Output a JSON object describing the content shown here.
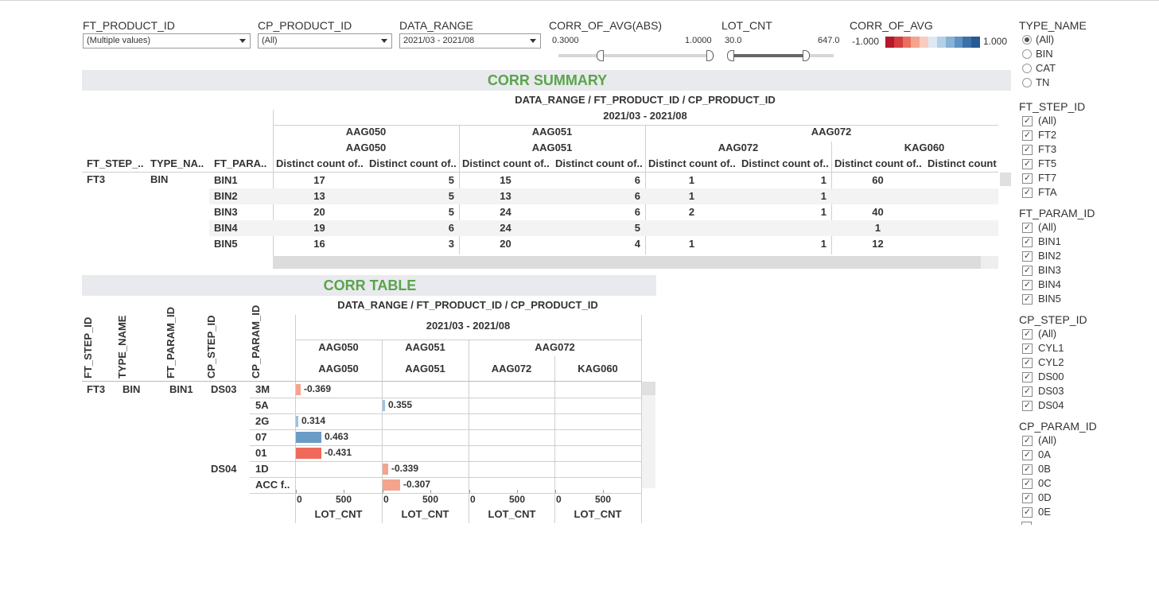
{
  "filters": {
    "ft_product_id": {
      "label": "FT_PRODUCT_ID",
      "value": "(Multiple values)"
    },
    "cp_product_id": {
      "label": "CP_PRODUCT_ID",
      "value": "(All)"
    },
    "data_range": {
      "label": "DATA_RANGE",
      "value": "2021/03 - 2021/08"
    },
    "corr_abs": {
      "label": "CORR_OF_AVG(ABS)",
      "min": "0.3000",
      "max": "1.0000"
    },
    "lot_cnt": {
      "label": "LOT_CNT",
      "min": "30.0",
      "max": "647.0"
    },
    "corr_avg": {
      "label": "CORR_OF_AVG",
      "min": "-1.000",
      "max": "1.000",
      "colors": [
        "#b5172b",
        "#d43c3f",
        "#e8705e",
        "#f4a48d",
        "#f8cdc0",
        "#dde9f3",
        "#b3d0e6",
        "#86b2d5",
        "#5d92c2",
        "#3c71a8",
        "#265a94"
      ]
    }
  },
  "summary": {
    "title": "CORR SUMMARY",
    "col_header_path": "DATA_RANGE  /  FT_PRODUCT_ID  /  CP_PRODUCT_ID",
    "date_range": "2021/03 - 2021/08",
    "row_headers": [
      "FT_STEP_..",
      "TYPE_NA..",
      "FT_PARA.."
    ],
    "ft_products": [
      "AAG050",
      "AAG051",
      "AAG072"
    ],
    "cp_products": [
      "AAG050",
      "AAG051",
      "AAG072",
      "KAG060"
    ],
    "measure_headers": [
      "Distinct count of..",
      "Distinct count of..",
      "Distinct count of..",
      "Distinct count of..",
      "Distinct count of..",
      "Distinct count of..",
      "Distinct count of..",
      "Distinct count"
    ],
    "ft_step": "FT3",
    "type_name": "BIN",
    "rows": [
      {
        "param": "BIN1",
        "values": [
          "17",
          "5",
          "15",
          "6",
          "1",
          "1",
          "60",
          ""
        ]
      },
      {
        "param": "BIN2",
        "values": [
          "13",
          "5",
          "13",
          "6",
          "1",
          "1",
          "",
          ""
        ]
      },
      {
        "param": "BIN3",
        "values": [
          "20",
          "5",
          "24",
          "6",
          "2",
          "1",
          "40",
          ""
        ]
      },
      {
        "param": "BIN4",
        "values": [
          "19",
          "6",
          "24",
          "5",
          "",
          "",
          "1",
          ""
        ]
      },
      {
        "param": "BIN5",
        "values": [
          "16",
          "3",
          "20",
          "4",
          "1",
          "1",
          "12",
          ""
        ]
      }
    ]
  },
  "corr_table": {
    "title": "CORR TABLE",
    "col_header_path": "DATA_RANGE  /  FT_PRODUCT_ID  /  CP_PRODUCT_ID",
    "date_range": "2021/03 - 2021/08",
    "row_headers": [
      "FT_STEP_ID",
      "TYPE_NAME",
      "FT_PARAM_ID",
      "CP_STEP_ID",
      "CP_PARAM_ID"
    ],
    "ft_products": [
      "AAG050",
      "AAG051",
      "AAG072"
    ],
    "cp_products": [
      "AAG050",
      "AAG051",
      "AAG072",
      "KAG060"
    ],
    "ft_step": "FT3",
    "type_name": "BIN",
    "ft_param": "BIN1",
    "cp_steps": [
      "DS03",
      "DS04"
    ],
    "axis_ticks": [
      "0",
      "500"
    ],
    "axis_title": "LOT_CNT"
  },
  "chart_data": {
    "type": "bar",
    "x_axis": {
      "title": "LOT_CNT",
      "ticks": [
        0,
        500
      ]
    },
    "columns": [
      "AAG050",
      "AAG051",
      "AAG072",
      "KAG060"
    ],
    "rows": [
      {
        "cp_step": "DS03",
        "cp_param": "3M",
        "col": 0,
        "lot_cnt": 50,
        "corr": -0.369,
        "label": "-0.369",
        "color": "#f4a48d"
      },
      {
        "cp_step": "",
        "cp_param": "5A",
        "col": 1,
        "lot_cnt": 25,
        "corr": 0.355,
        "label": "0.355",
        "color": "#9cc2e0"
      },
      {
        "cp_step": "",
        "cp_param": "2G",
        "col": 0,
        "lot_cnt": 20,
        "corr": 0.314,
        "label": "0.314",
        "color": "#9cc2e0"
      },
      {
        "cp_step": "",
        "cp_param": "07",
        "col": 0,
        "lot_cnt": 270,
        "corr": 0.463,
        "label": "0.463",
        "color": "#6a9cc6"
      },
      {
        "cp_step": "",
        "cp_param": "01",
        "col": 0,
        "lot_cnt": 270,
        "corr": -0.431,
        "label": "-0.431",
        "color": "#ef6a5a"
      },
      {
        "cp_step": "DS04",
        "cp_param": "1D",
        "col": 1,
        "lot_cnt": 55,
        "corr": -0.339,
        "label": "-0.339",
        "color": "#f4a48d"
      },
      {
        "cp_step": "",
        "cp_param": "ACC  f..",
        "col": 1,
        "lot_cnt": 180,
        "corr": -0.307,
        "label": "-0.307",
        "color": "#f4a48d"
      }
    ]
  },
  "right_panel": {
    "type_name": {
      "title": "TYPE_NAME",
      "items": [
        "(All)",
        "BIN",
        "CAT",
        "TN"
      ],
      "selected": 0
    },
    "ft_step_id": {
      "title": "FT_STEP_ID",
      "items": [
        "(All)",
        "FT2",
        "FT3",
        "FT5",
        "FT7",
        "FTA"
      ]
    },
    "ft_param_id": {
      "title": "FT_PARAM_ID",
      "items": [
        "(All)",
        "BIN1",
        "BIN2",
        "BIN3",
        "BIN4",
        "BIN5"
      ]
    },
    "cp_step_id": {
      "title": "CP_STEP_ID",
      "items": [
        "(All)",
        "CYL1",
        "CYL2",
        "DS00",
        "DS03",
        "DS04"
      ]
    },
    "cp_param_id": {
      "title": "CP_PARAM_ID",
      "items": [
        "(All)",
        "0A",
        "0B",
        "0C",
        "0D",
        "0E"
      ]
    },
    "check_mark": "✓"
  }
}
